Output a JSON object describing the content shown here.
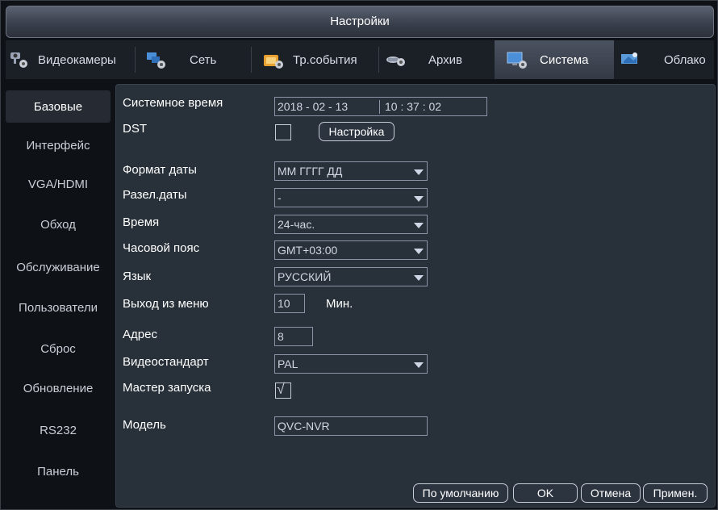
{
  "window": {
    "title": "Настройки"
  },
  "tabs": [
    {
      "label": "Видеокамеры",
      "icon": "camera-icon"
    },
    {
      "label": "Сеть",
      "icon": "network-icon"
    },
    {
      "label": "Тр.события",
      "icon": "alarm-event-icon"
    },
    {
      "label": "Архив",
      "icon": "storage-icon"
    },
    {
      "label": "Система",
      "icon": "system-icon",
      "active": true
    },
    {
      "label": "Облако",
      "icon": "cloud-icon"
    }
  ],
  "sidebar": {
    "items": [
      {
        "label": "Базовые",
        "active": true
      },
      {
        "label": "Интерфейс"
      },
      {
        "label": "VGA/HDMI"
      },
      {
        "label": "Обход"
      },
      {
        "label": "Обслуживание"
      },
      {
        "label": "Пользователи"
      },
      {
        "label": "Сброс"
      },
      {
        "label": "Обновление"
      },
      {
        "label": "RS232"
      },
      {
        "label": "Панель"
      }
    ]
  },
  "form": {
    "system_time": {
      "label": "Системное время",
      "date": "2018  - 02 - 13",
      "time": "10 : 37 : 02"
    },
    "dst": {
      "label": "DST",
      "checked": false,
      "button": "Настройка"
    },
    "date_format": {
      "label": "Формат даты",
      "value": "ММ ГГГГ ДД"
    },
    "date_separator": {
      "label": "Разел.даты",
      "value": "-"
    },
    "time_format": {
      "label": "Время",
      "value": "24-час."
    },
    "timezone": {
      "label": "Часовой пояс",
      "value": "GMT+03:00"
    },
    "language": {
      "label": "Язык",
      "value": "РУССКИЙ"
    },
    "menu_logout": {
      "label": "Выход из меню",
      "value": "10",
      "unit": "Мин."
    },
    "address": {
      "label": "Адрес",
      "value": "8"
    },
    "video_standard": {
      "label": "Видеостандарт",
      "value": "PAL"
    },
    "startup_wizard": {
      "label": "Мастер запуска",
      "checked": true,
      "mark": "√"
    },
    "model": {
      "label": "Модель",
      "value": "QVC-NVR"
    }
  },
  "buttons": {
    "default": "По умолчанию",
    "ok": "OK",
    "cancel": "Отмена",
    "apply": "Примен."
  },
  "colors": {
    "panel": "#283039",
    "field_border": "#8a93a8",
    "title_bar": "#4a5260"
  }
}
